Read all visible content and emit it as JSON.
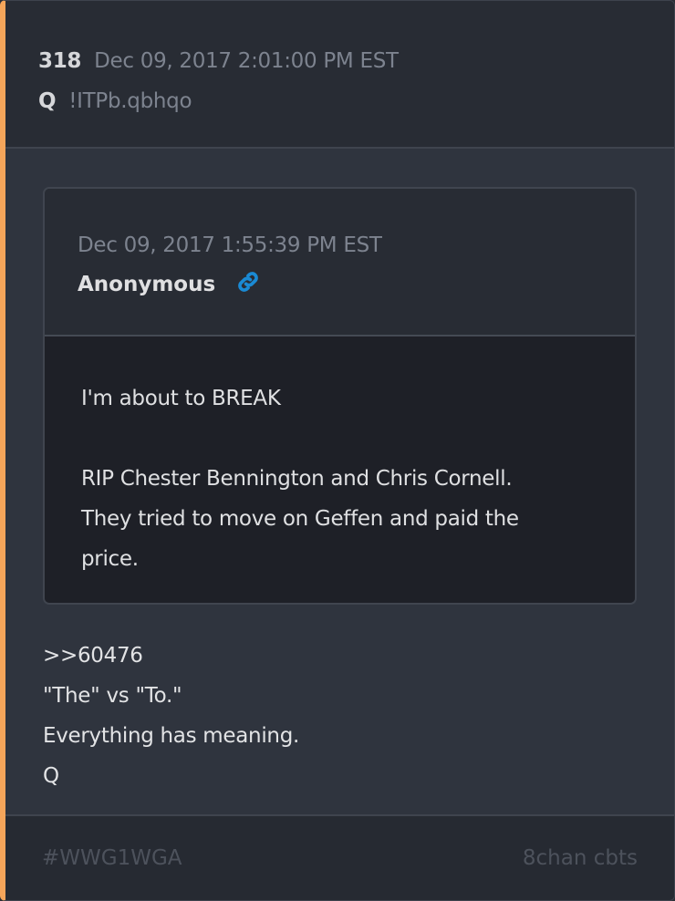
{
  "post": {
    "number": "318",
    "timestamp": "Dec 09, 2017 2:01:00 PM EST",
    "author": "Q",
    "tripcode": "!ITPb.qbhqo"
  },
  "quote": {
    "timestamp": "Dec 09, 2017 1:55:39 PM EST",
    "author": "Anonymous",
    "lines": [
      "I'm about to BREAK",
      "",
      "RIP Chester Bennington and Chris Cornell.",
      "They tried to move on Geffen and paid the",
      "price."
    ]
  },
  "body": {
    "lines": [
      ">>60476",
      "\"The\" vs \"To.\"",
      "Everything has meaning.",
      "Q"
    ]
  },
  "footer": {
    "hashtag": "#WWG1WGA",
    "source": "8chan cbts"
  },
  "colors": {
    "accent": "#f5a55a",
    "link": "#1a8ad4"
  }
}
